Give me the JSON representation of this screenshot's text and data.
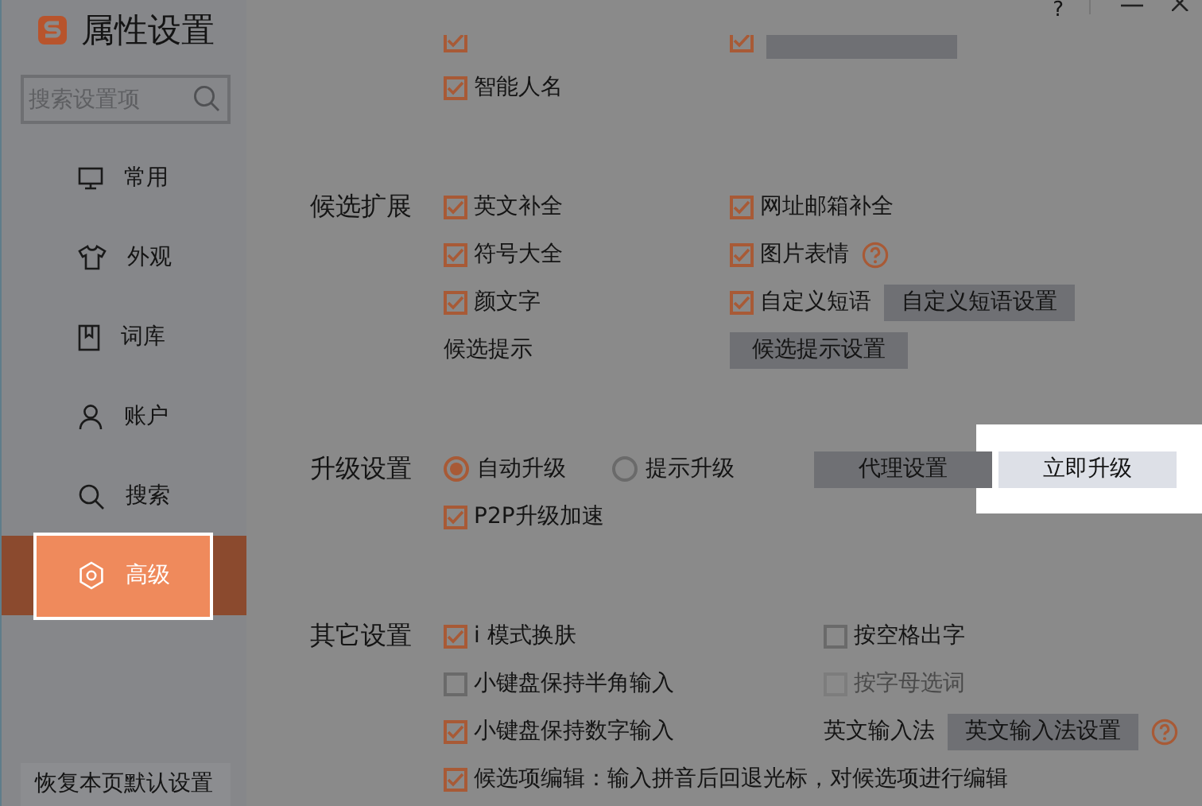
{
  "window": {
    "title": "属性设置",
    "help": "?"
  },
  "sidebar": {
    "search": {
      "placeholder": "搜索设置项"
    },
    "items": [
      {
        "label": "常用",
        "selected": false
      },
      {
        "label": "外观",
        "selected": false
      },
      {
        "label": "词库",
        "selected": false
      },
      {
        "label": "账户",
        "selected": false
      },
      {
        "label": "搜索",
        "selected": false
      },
      {
        "label": "高级",
        "selected": true
      }
    ],
    "restore_button": "恢复本页默认设置"
  },
  "sections": [
    {
      "rows": [
        [
          {
            "kind": "checkbox",
            "checked": true
          },
          {
            "kind": "checkbox",
            "checked": true
          },
          {
            "kind": "button"
          }
        ],
        [
          {
            "kind": "checkbox",
            "label": "智能人名",
            "checked": true
          }
        ]
      ]
    },
    {
      "label": "候选扩展",
      "rows": [
        [
          {
            "kind": "checkbox",
            "label": "英文补全",
            "checked": true
          },
          {
            "kind": "checkbox",
            "label": "网址邮箱补全",
            "checked": true
          }
        ],
        [
          {
            "kind": "checkbox",
            "label": "符号大全",
            "checked": true
          },
          {
            "kind": "checkbox",
            "label": "图片表情",
            "checked": true
          },
          {
            "kind": "help"
          }
        ],
        [
          {
            "kind": "checkbox",
            "label": "颜文字",
            "checked": true
          },
          {
            "kind": "checkbox",
            "label": "自定义短语",
            "checked": true
          },
          {
            "kind": "button",
            "label": "自定义短语设置"
          }
        ],
        [
          {
            "kind": "text",
            "label": "候选提示"
          },
          {
            "kind": "button",
            "label": "候选提示设置"
          }
        ]
      ]
    },
    {
      "label": "升级设置",
      "rows": [
        [
          {
            "kind": "radio",
            "label": "自动升级",
            "selected": true
          },
          {
            "kind": "radio",
            "label": "提示升级",
            "selected": false
          },
          {
            "kind": "button",
            "label": "代理设置"
          },
          {
            "kind": "button",
            "label": "立即升级",
            "highlighted": true
          }
        ],
        [
          {
            "kind": "checkbox",
            "label": "P2P升级加速",
            "checked": true
          }
        ]
      ]
    },
    {
      "label": "其它设置",
      "rows": [
        [
          {
            "kind": "checkbox",
            "label": "i 模式换肤",
            "checked": true
          },
          {
            "kind": "checkbox",
            "label": "按空格出字",
            "checked": false
          }
        ],
        [
          {
            "kind": "checkbox",
            "label": "小键盘保持半角输入",
            "checked": false
          },
          {
            "kind": "checkbox",
            "label": "按字母选词",
            "checked": false,
            "disabled": true
          }
        ],
        [
          {
            "kind": "checkbox",
            "label": "小键盘保持数字输入",
            "checked": true
          },
          {
            "kind": "text",
            "label": "英文输入法"
          },
          {
            "kind": "button",
            "label": "英文输入法设置"
          },
          {
            "kind": "help"
          }
        ],
        [
          {
            "kind": "checkbox",
            "label": "候选项编辑：输入拼音后回退光标，对候选项进行编辑",
            "checked": true
          }
        ]
      ]
    }
  ]
}
